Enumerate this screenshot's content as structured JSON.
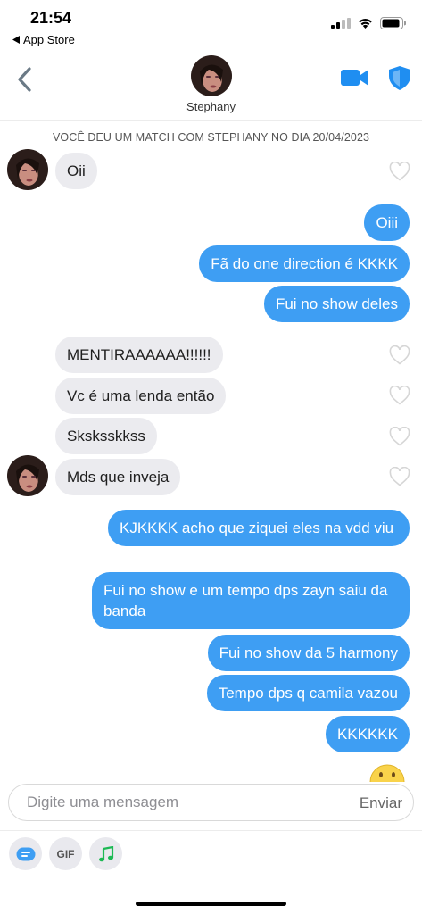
{
  "status": {
    "time": "21:54",
    "back_app": "App Store"
  },
  "header": {
    "name": "Stephany"
  },
  "match_text": "VOCÊ DEU UM MATCH COM STEPHANY NO DIA 20/04/2023",
  "messages": [
    {
      "text": "Oii"
    },
    {
      "text": "Oiii"
    },
    {
      "text": "Fã do one direction é KKKK"
    },
    {
      "text": "Fui no show deles"
    },
    {
      "text": "MENTIRAAAAAA!!!!!!"
    },
    {
      "text": "Vc é uma lenda então"
    },
    {
      "text": "Sksksskkss"
    },
    {
      "text": "Mds que inveja"
    },
    {
      "text": "KJKKKK acho que ziquei eles na vdd viu"
    },
    {
      "text": "Fui no show e um tempo dps zayn saiu da banda"
    },
    {
      "text": "Fui no show da 5 harmony"
    },
    {
      "text": "Tempo dps q camila vazou"
    },
    {
      "text": "KKKKKK"
    }
  ],
  "composer": {
    "placeholder": "Digite uma mensagem",
    "send_label": "Enviar"
  },
  "tools": {
    "gif_label": "GIF"
  },
  "colors": {
    "outgoing_bubble": "#3e9ef3",
    "incoming_bubble": "#ebebef",
    "accent": "#1f8ef1"
  },
  "icons": [
    "back-chevron",
    "video-camera",
    "shield",
    "heart-outline",
    "sticker",
    "gif",
    "music-note"
  ]
}
